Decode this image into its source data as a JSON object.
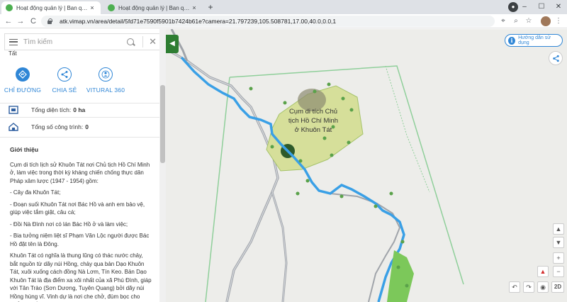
{
  "browser": {
    "tabs": [
      {
        "title": "Hoạt động quản lý | Ban quản lý",
        "close": "×"
      },
      {
        "title": "Hoạt động quản lý | Ban quản lý",
        "close": "×"
      }
    ],
    "new_tab": "+",
    "window_controls": {
      "minimize": "–",
      "maximize": "☐",
      "close": "✕"
    },
    "url": "atk.vimap.vn/area/detail/5fd71e7590f5901b7424b61e?camera=21.797239,105.508781,17.00,40.0,0.0,1",
    "nav": {
      "back": "←",
      "forward": "→",
      "reload": "C"
    }
  },
  "search": {
    "placeholder": "Tìm kiếm",
    "close": "✕"
  },
  "truncated_heading": "Tất",
  "actions": [
    {
      "label": "CHỈ ĐƯỜNG",
      "icon": "directions-icon"
    },
    {
      "label": "CHIA SẺ",
      "icon": "share-icon"
    },
    {
      "label": "VITURAL 360",
      "icon": "vr360-icon"
    }
  ],
  "stats": {
    "area_label": "Tổng diện tích:",
    "area_value": "0 ha",
    "works_label": "Tổng số công trình:",
    "works_value": "0"
  },
  "intro": {
    "heading": "Giới thiệu",
    "paragraphs": [
      "Cụm di tích lịch sử Khuôn Tát nơi Chủ tịch Hồ Chí Minh ở, làm việc trong thời kỳ kháng chiến chống thực dân Pháp xâm lược (1947 - 1954) gồm:",
      "- Cây đa Khuôn Tát;",
      "- Đoạn suối Khuôn Tát nơi Bác Hồ và anh em bảo vệ, giúp việc tắm giặt, câu cá;",
      "- Đồi Nà Đình nơi có lán Bác Hồ ở và làm việc;",
      "- Bia tưởng niệm liệt sĩ Phạm Văn Lộc người được Bác Hồ đặt tên là Đông.",
      "Khuôn Tát có nghĩa là thung lũng có thác nước chảy, bắt nguồn từ dãy núi Hồng, chảy qua bản Dạo Khuôn Tát, xuôi xuống cách đồng Nà Lơm, Tín Keo. Bản Dạo Khuôn Tát là địa điểm xa xôi nhất của xã Phú Đình, giáp với Tân Trào (Sơn Dương, Tuyên Quang) bởi dãy núi Hồng hùng vĩ. Vinh dự là nơi che chở, đùm bọc cho Chủ tịch Hồ Chí Minh"
    ]
  },
  "map": {
    "area_label": "Cụm di tích Chủ tịch Hồ Chí Minh ở Khuôn Tát",
    "guide_button": "Hướng dẫn sử dụng",
    "guide_icon": "i",
    "controls": {
      "up": "▲",
      "down": "▼",
      "zoom_in": "+",
      "zoom_out": "−",
      "north": "▲",
      "rotate_left": "↶",
      "rotate_right": "↷",
      "locate": "◉",
      "view_mode": "2D"
    }
  },
  "colors": {
    "accent": "#2f86d6",
    "panel_toggle": "#2e7d32",
    "area_fill": "#d6df9a",
    "river": "#3aa0e6",
    "road": "#a0a4aa"
  }
}
